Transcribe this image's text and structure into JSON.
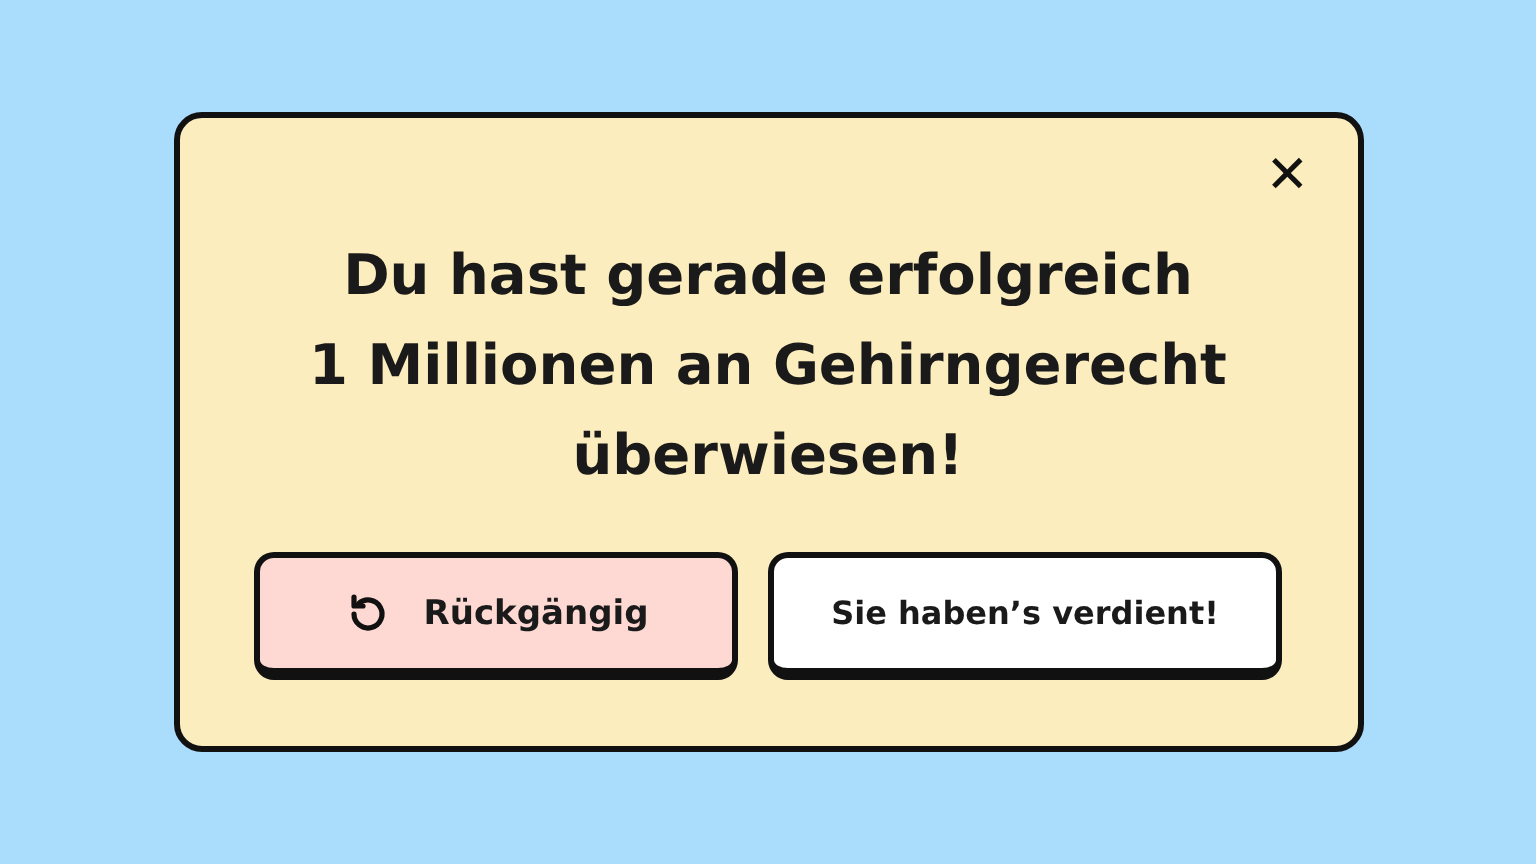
{
  "dialog": {
    "message": "Du hast gerade erfolgreich\n1 Millionen an Gehirngerecht\nüberwiesen!",
    "close_label": "✕",
    "buttons": [
      {
        "label": "Rückgängig",
        "kind": "undo"
      },
      {
        "label": "Sie haben’s verdient!",
        "kind": "plain"
      }
    ]
  }
}
